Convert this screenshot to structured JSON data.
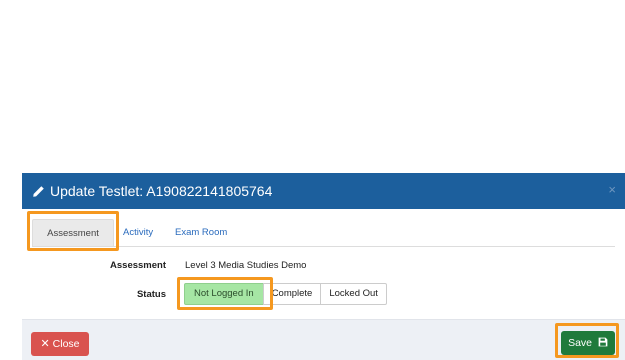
{
  "modal": {
    "title": "Update Testlet: A190822141805764",
    "header_close_glyph": "×"
  },
  "tabs": [
    {
      "label": "Assessment",
      "active": true
    },
    {
      "label": "Activity",
      "active": false
    },
    {
      "label": "Exam Room",
      "active": false
    }
  ],
  "fields": {
    "assessment_label": "Assessment",
    "assessment_value": "Level 3 Media Studies Demo",
    "status_label": "Status"
  },
  "status_options": [
    {
      "label": "Not Logged In",
      "selected": true
    },
    {
      "label": "Complete",
      "selected": false
    },
    {
      "label": "Locked Out",
      "selected": false
    }
  ],
  "footer": {
    "close_glyph": "✕",
    "close_label": "Close",
    "save_label": "Save"
  },
  "icons": {
    "title_icon": "pencil-icon",
    "save_icon": "floppy-disk-icon",
    "close_icon": "x-icon"
  },
  "colors": {
    "header": "#1c5f9d",
    "selected_status": "#a6e6a4",
    "close_button": "#d9534f",
    "save_button": "#1f7a3b",
    "highlight": "#f5981f"
  }
}
